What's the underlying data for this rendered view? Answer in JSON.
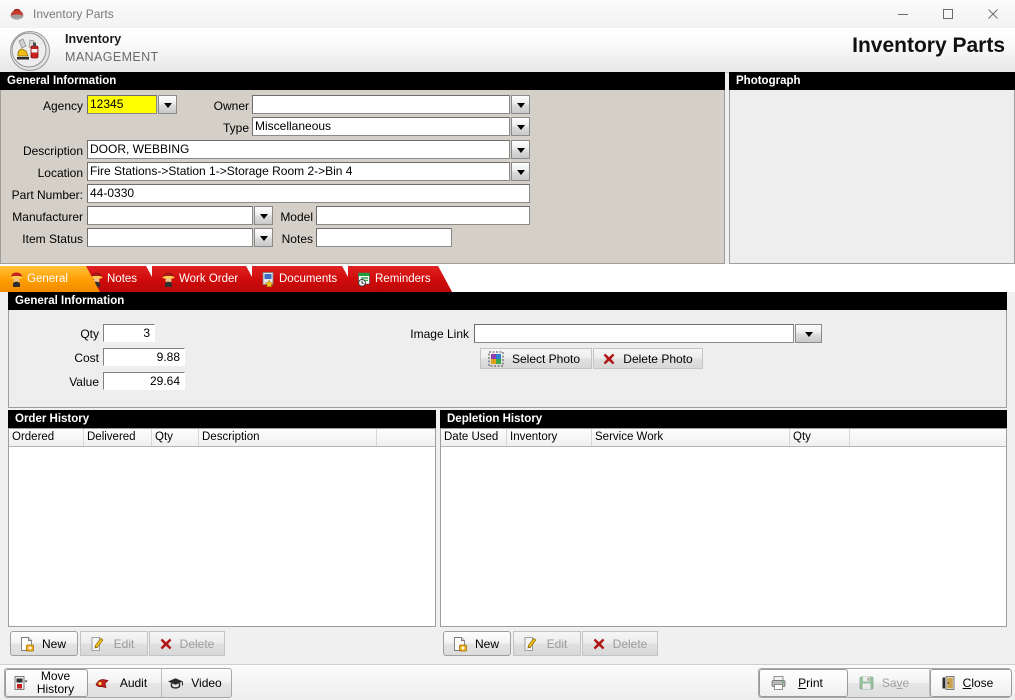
{
  "window": {
    "title": "Inventory Parts",
    "app_icon": "fire-helmet-icon",
    "minimize": "—",
    "maximize": "□",
    "close": "×"
  },
  "header": {
    "logo_icon": "fire-boot-extinguisher-logo",
    "line1": "Inventory",
    "line2": "MANAGEMENT",
    "right_title": "Inventory Parts"
  },
  "top_section": {
    "title": "General Information",
    "photograph_title": "Photograph",
    "fields": {
      "agency_label": "Agency",
      "agency_value": "12345",
      "owner_label": "Owner",
      "owner_value": "",
      "type_label": "Type",
      "type_value": "Miscellaneous",
      "description_label": "Description",
      "description_value": "DOOR, WEBBING",
      "location_label": "Location",
      "location_value": "Fire Stations->Station 1->Storage Room 2->Bin 4",
      "part_number_label": "Part Number:",
      "part_number_value": "44-0330",
      "manufacturer_label": "Manufacturer",
      "manufacturer_value": "",
      "model_label": "Model",
      "model_value": "",
      "item_status_label": "Item Status",
      "item_status_value": "",
      "notes_label": "Notes",
      "notes_value": ""
    }
  },
  "tabs": [
    {
      "label": "General",
      "icon": "firefighter-icon",
      "active": true
    },
    {
      "label": "Notes",
      "icon": "firefighter-icon",
      "active": false
    },
    {
      "label": "Work Order",
      "icon": "firefighter-icon",
      "active": false
    },
    {
      "label": "Documents",
      "icon": "document-star-icon",
      "active": false
    },
    {
      "label": "Reminders",
      "icon": "calendar-clock-icon",
      "active": false
    }
  ],
  "general_tab": {
    "title": "General Information",
    "qty_label": "Qty",
    "qty_value": "3",
    "cost_label": "Cost",
    "cost_value": "9.88",
    "value_label": "Value",
    "value_value": "29.64",
    "image_link_label": "Image Link",
    "image_link_value": "",
    "select_photo_label": "Select Photo",
    "select_photo_icon": "photo-select-icon",
    "delete_photo_label": "Delete Photo",
    "delete_photo_icon": "red-x-icon"
  },
  "order_history": {
    "title": "Order History",
    "columns": [
      "Ordered",
      "Delivered",
      "Qty",
      "Description"
    ],
    "rows": [],
    "buttons": [
      {
        "label": "New",
        "icon": "new-page-icon",
        "enabled": true
      },
      {
        "label": "Edit",
        "icon": "pencil-icon",
        "enabled": false
      },
      {
        "label": "Delete",
        "icon": "red-x-icon",
        "enabled": false
      }
    ]
  },
  "depletion_history": {
    "title": "Depletion History",
    "columns": [
      "Date Used",
      "Inventory",
      "Service Work",
      "Qty"
    ],
    "rows": [],
    "buttons": [
      {
        "label": "New",
        "icon": "new-page-icon",
        "enabled": true
      },
      {
        "label": "Edit",
        "icon": "pencil-icon",
        "enabled": false
      },
      {
        "label": "Delete",
        "icon": "red-x-icon",
        "enabled": false
      }
    ]
  },
  "toolbar": {
    "left": [
      {
        "label": "Move\nHistory",
        "icon": "move-history-icon",
        "enabled": true,
        "selected": true
      },
      {
        "label": "Audit",
        "icon": "audit-icon",
        "enabled": true,
        "selected": false
      },
      {
        "label": "Video",
        "icon": "graduation-cap-icon",
        "enabled": true,
        "selected": false
      }
    ],
    "right": [
      {
        "label": "Print",
        "accel": "P",
        "icon": "printer-icon",
        "enabled": true
      },
      {
        "label": "Save",
        "accel": "v",
        "icon": "floppy-disk-icon",
        "enabled": false
      },
      {
        "label": "Close",
        "accel": "C",
        "icon": "exit-door-icon",
        "enabled": true
      }
    ]
  },
  "colors": {
    "section_bar": "#000000",
    "tab_red": "#cf0a0a",
    "tab_active_orange": "#ff9d00",
    "form_background": "#d4d0c8",
    "highlight_field": "#ffff00"
  }
}
